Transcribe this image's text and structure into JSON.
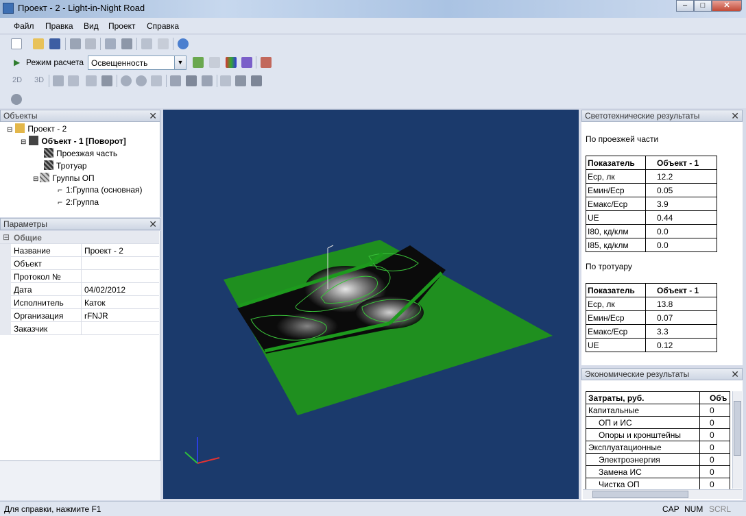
{
  "window": {
    "title": "Проект - 2 - Light-in-Night Road"
  },
  "menu": [
    "Файл",
    "Правка",
    "Вид",
    "Проект",
    "Справка"
  ],
  "toolbar": {
    "mode_label": "Режим расчета",
    "mode_value": "Освещенность",
    "btn_2d": "2D",
    "btn_3d": "3D"
  },
  "objects_panel": {
    "title": "Объекты",
    "tree": [
      {
        "label": "Проект - 2"
      },
      {
        "label": "Объект - 1 [Поворот]"
      },
      {
        "label": "Проезжая часть"
      },
      {
        "label": "Тротуар"
      },
      {
        "label": "Группы ОП"
      },
      {
        "label": "1:Группа (основная)"
      },
      {
        "label": "2:Группа"
      }
    ]
  },
  "params_panel": {
    "title": "Параметры",
    "group": "Общие",
    "rows": [
      {
        "key": "Название",
        "value": "Проект - 2"
      },
      {
        "key": "Объект",
        "value": ""
      },
      {
        "key": "Протокол №",
        "value": ""
      },
      {
        "key": "Дата",
        "value": "04/02/2012"
      },
      {
        "key": "Исполнитель",
        "value": "Каток"
      },
      {
        "key": "Организация",
        "value": "rFNJR"
      },
      {
        "key": "Заказчик",
        "value": ""
      }
    ]
  },
  "lighting_panel": {
    "title": "Светотехнические результаты",
    "roadway_heading": "По проезжей части",
    "sidewalk_heading": "По тротуару",
    "col_indicator": "Показатель",
    "col_object": "Объект - 1",
    "roadway": [
      {
        "k": "Eср, лк",
        "v": "12.2"
      },
      {
        "k": "Eмин/Eср",
        "v": "0.05"
      },
      {
        "k": "Eмакс/Eср",
        "v": "3.9"
      },
      {
        "k": "UE",
        "v": "0.44"
      },
      {
        "k": "I80, кд/клм",
        "v": "0.0"
      },
      {
        "k": "I85, кд/клм",
        "v": "0.0"
      }
    ],
    "sidewalk": [
      {
        "k": "Eср, лк",
        "v": "13.8"
      },
      {
        "k": "Eмин/Eср",
        "v": "0.07"
      },
      {
        "k": "Eмакс/Eср",
        "v": "3.3"
      },
      {
        "k": "UE",
        "v": "0.12"
      }
    ]
  },
  "econ_panel": {
    "title": "Экономические результаты",
    "col_cost": "Затраты, руб.",
    "col_obj": "Объ",
    "rows": [
      {
        "k": "Капитальные",
        "v": "0",
        "indent": false
      },
      {
        "k": "ОП и ИС",
        "v": "0",
        "indent": true
      },
      {
        "k": "Опоры и кронштейны",
        "v": "0",
        "indent": true
      },
      {
        "k": "Эксплуатационные",
        "v": "0",
        "indent": false
      },
      {
        "k": "Электроэнергия",
        "v": "0",
        "indent": true
      },
      {
        "k": "Замена ИС",
        "v": "0",
        "indent": true
      },
      {
        "k": "Чистка ОП",
        "v": "0",
        "indent": true
      }
    ]
  },
  "status": {
    "help": "Для справки, нажмите F1",
    "cap": "CAP",
    "num": "NUM",
    "scrl": "SCRL"
  }
}
